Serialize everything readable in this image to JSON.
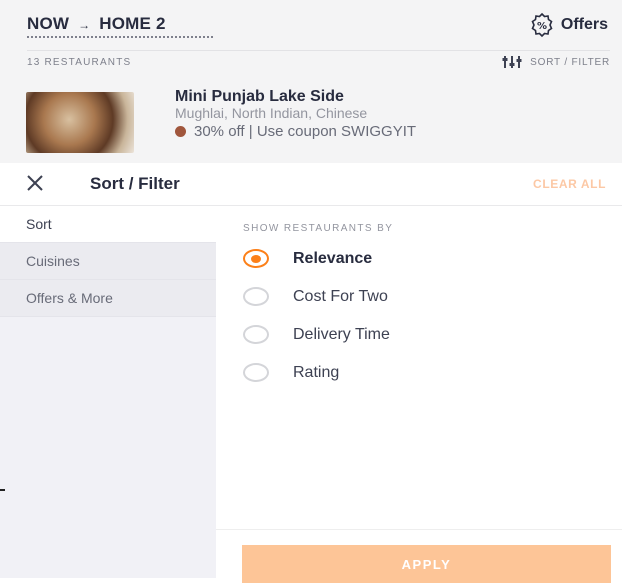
{
  "location": {
    "now": "NOW",
    "arrow": "→",
    "place": "HOME 2"
  },
  "offers_label": "Offers",
  "restaurant_count": "13 RESTAURANTS",
  "sort_filter_label": "SORT / FILTER",
  "restaurant": {
    "name": "Mini Punjab Lake Side",
    "cuisines": "Mughlai, North Indian, Chinese",
    "offer": "30% off | Use coupon SWIGGYIT"
  },
  "sheet": {
    "title": "Sort / Filter",
    "clear_all": "CLEAR ALL",
    "sidebar": [
      "Sort",
      "Cuisines",
      "Offers & More"
    ],
    "section_heading": "SHOW RESTAURANTS BY",
    "options": [
      "Relevance",
      "Cost For Two",
      "Delivery Time",
      "Rating"
    ],
    "selected_index": 0,
    "apply": "APPLY"
  },
  "colors": {
    "accent": "#fc8019",
    "apply_bg": "#fdc597",
    "clear_all": "#fcc8a5"
  },
  "icons": {
    "offers": "discount-badge-icon",
    "sort": "sliders-icon",
    "close": "close-icon"
  }
}
